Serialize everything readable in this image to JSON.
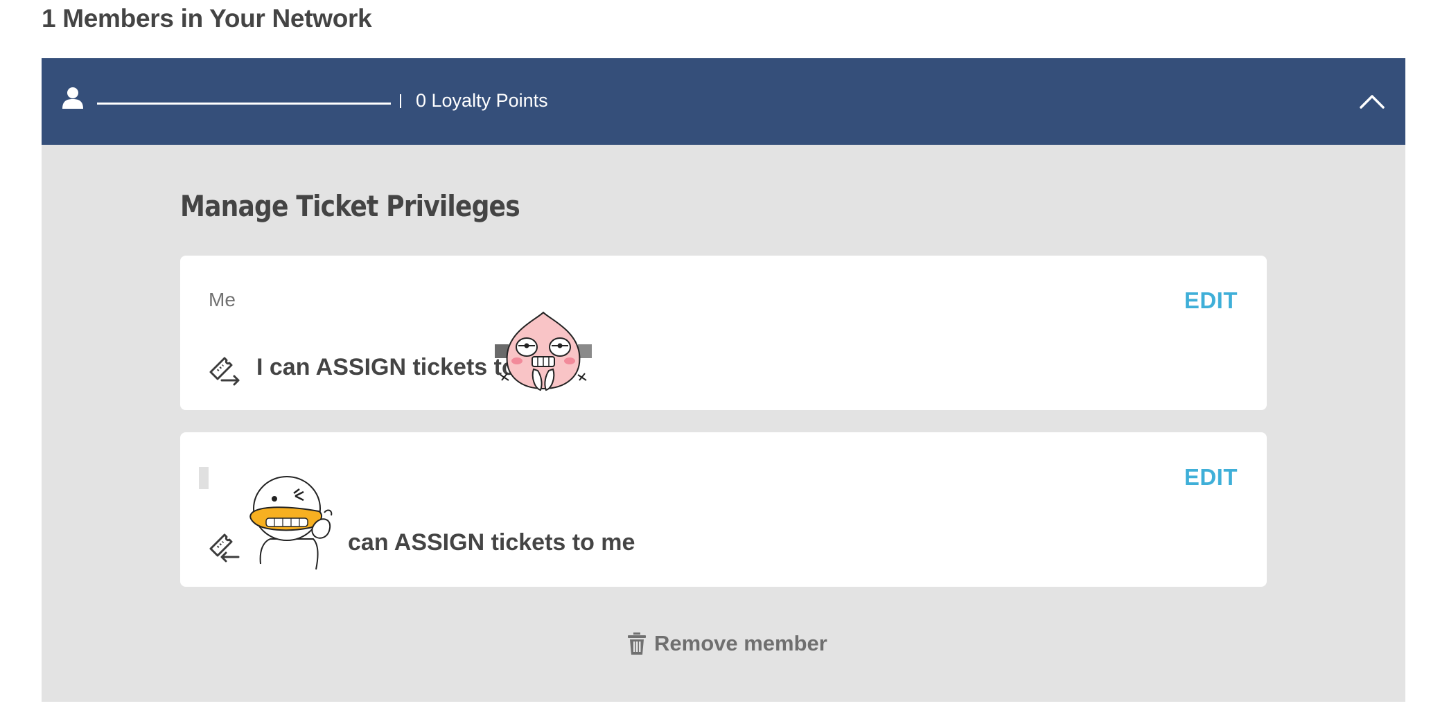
{
  "page": {
    "title": "1 Members in Your Network"
  },
  "member": {
    "name": "",
    "loyalty_points": "0 Loyalty Points",
    "expanded": true
  },
  "privileges": {
    "heading": "Manage Ticket Privileges",
    "cards": [
      {
        "label": "Me",
        "text": "I can ASSIGN tickets to",
        "edit_label": "EDIT",
        "icon": "ticket-assign-out-icon",
        "sticker": "peach-character-sticker"
      },
      {
        "label": "",
        "text": "can ASSIGN tickets to me",
        "edit_label": "EDIT",
        "icon": "ticket-assign-in-icon",
        "sticker": "duck-character-sticker"
      }
    ]
  },
  "actions": {
    "remove_member_label": "Remove member",
    "remove_icon": "trash-icon"
  },
  "colors": {
    "header_bg": "#354f7a",
    "body_bg": "#e3e3e3",
    "edit_link": "#3fafd8",
    "title_text": "#444444"
  }
}
